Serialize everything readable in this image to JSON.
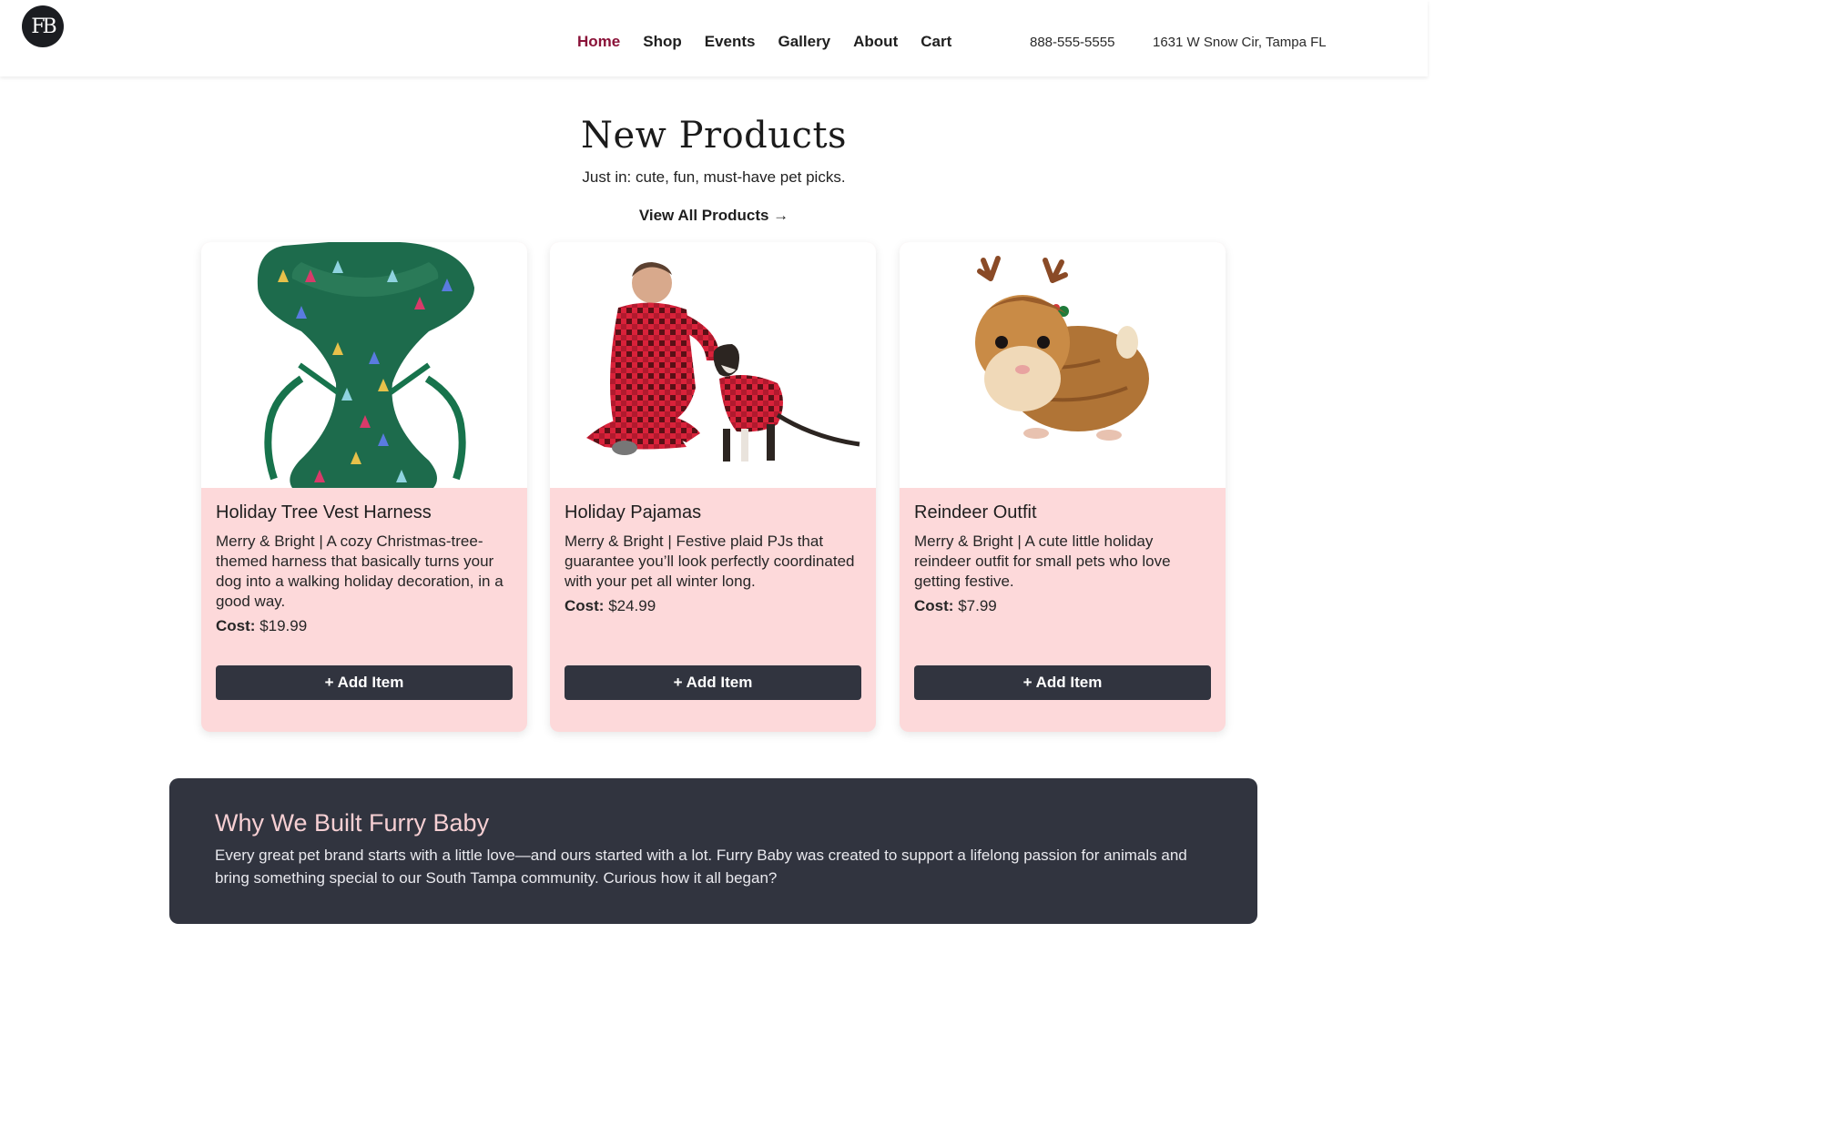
{
  "header": {
    "logo_text": "FB",
    "nav": [
      "Home",
      "Shop",
      "Events",
      "Gallery",
      "About",
      "Cart"
    ],
    "active_nav": "Home",
    "phone": "888-555-5555",
    "address": "1631 W Snow Cir, Tampa FL"
  },
  "new_products": {
    "title": "New Products",
    "subtitle": "Just in: cute, fun, must-have pet picks.",
    "view_all": "View All Products →"
  },
  "products": [
    {
      "name": "Holiday Tree Vest Harness",
      "description": "Merry & Bright | A cozy Christmas-tree-themed harness that basically turns your dog into a walking holiday decoration, in a good way.",
      "cost_label": "Cost:",
      "price": "$19.99",
      "button": "+ Add Item"
    },
    {
      "name": "Holiday Pajamas",
      "description": "Merry & Bright | Festive plaid PJs that guarantee you’ll look perfectly coordinated with your pet all winter long.",
      "cost_label": "Cost:",
      "price": "$24.99",
      "button": "+ Add Item"
    },
    {
      "name": "Reindeer Outfit",
      "description": "Merry & Bright | A cute little holiday reindeer outfit for small pets who love getting festive.",
      "cost_label": "Cost:",
      "price": "$7.99",
      "button": "+ Add Item"
    }
  ],
  "about": {
    "title": "Why We Built Furry Baby",
    "text": "Every great pet brand starts with a little love—and ours started with a lot. Furry Baby was created to support a lifelong passion for animals and bring something special to our South Tampa community. Curious how it all began?"
  },
  "colors": {
    "accent_nav": "#8a1238",
    "card_bg": "#fdd9da",
    "dark": "#31343f",
    "about_title": "#f6cfd3"
  }
}
